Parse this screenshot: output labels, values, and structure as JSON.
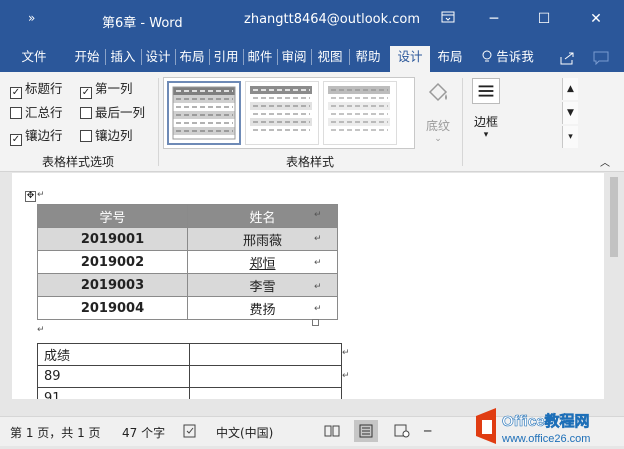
{
  "window": {
    "quick_access": "»",
    "doc_title": "第6章 - Word",
    "account": "zhangtt8464@outlook.com",
    "restore_ribbon_icon": "ribbon-display-icon",
    "minimize": "─",
    "maximize": "☐",
    "close": "✕"
  },
  "tabs": [
    "文件",
    "开始",
    "插入",
    "设计",
    "布局",
    "引用",
    "邮件",
    "审阅",
    "视图",
    "帮助",
    "设计",
    "布局"
  ],
  "active_tab_index": 10,
  "tell_me": "告诉我",
  "ribbon": {
    "style_options": {
      "header_row": "标题行",
      "first_column": "第一列",
      "total_row": "汇总行",
      "last_column": "最后一列",
      "banded_rows": "镶边行",
      "banded_columns": "镶边列",
      "checked": {
        "header_row": true,
        "first_column": true,
        "total_row": false,
        "last_column": false,
        "banded_rows": true,
        "banded_columns": false
      },
      "group_label": "表格样式选项"
    },
    "styles_group_label": "表格样式",
    "shading_label": "底纹",
    "borders_label": "边框"
  },
  "table1": {
    "headers": [
      "学号",
      "姓名"
    ],
    "rows": [
      [
        "2019001",
        "邢雨薇"
      ],
      [
        "2019002",
        "郑恒"
      ],
      [
        "2019003",
        "李雪"
      ],
      [
        "2019004",
        "费扬"
      ]
    ]
  },
  "table2": {
    "rows": [
      [
        "成绩",
        ""
      ],
      [
        "89",
        ""
      ],
      [
        "91",
        ""
      ]
    ]
  },
  "status": {
    "page": "第 1 页，共 1 页",
    "words": "47 个字",
    "language": "中文(中国)"
  },
  "watermark": {
    "text": "Office教程网",
    "url": "www.office26.com"
  },
  "colors": {
    "word_blue": "#2b579a",
    "table_header": "#8c8c8c",
    "band": "#d9d9d9"
  }
}
